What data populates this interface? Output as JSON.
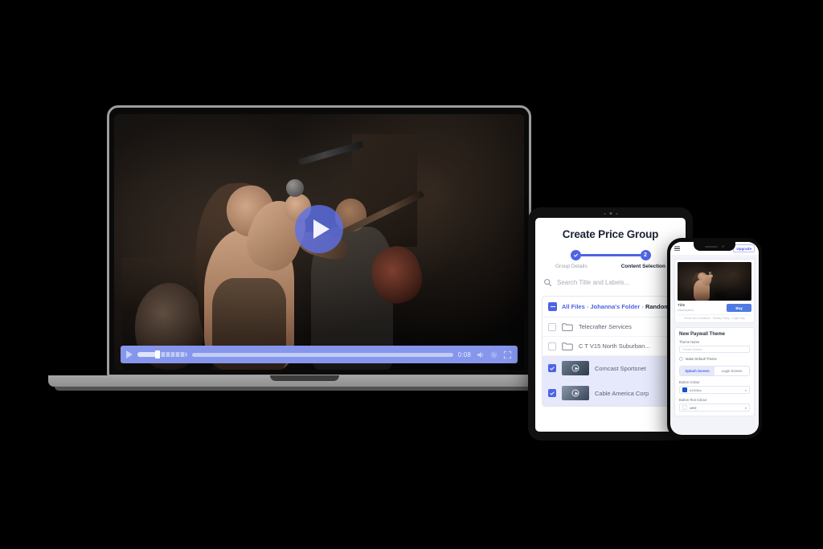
{
  "scene": {
    "background": "#000000",
    "devices": [
      "laptop",
      "tablet",
      "phone"
    ]
  },
  "laptop": {
    "device_name": "laptop",
    "video": {
      "play_overlay": "play-circle-icon",
      "controls": {
        "play_label": "play-icon",
        "volume_icon": "volume-icon",
        "current_time": "0:08",
        "settings_icon": "settings-icon",
        "fullscreen_icon": "fullscreen-icon",
        "volume_level_pct": 38,
        "seek_progress_pct": 1
      },
      "accent_color": "#8596ec"
    }
  },
  "tablet": {
    "device_name": "tablet",
    "title": "Create Price Group",
    "stepper": {
      "steps": [
        {
          "label": "Group Details",
          "state": "done",
          "marker": "check-icon"
        },
        {
          "label": "Content Selection",
          "state": "active",
          "marker": "2"
        }
      ],
      "accent_color": "#4e63e4"
    },
    "search": {
      "icon": "search-icon",
      "placeholder": "Search Title and Labels..."
    },
    "breadcrumb": {
      "toggle_icon": "minus-box-icon",
      "root": "All Files",
      "sep": "›",
      "folder": "Johanna's Folder",
      "current": "Random"
    },
    "file_rows": [
      {
        "type": "folder",
        "name": "Telecrafter Services",
        "checked": false,
        "icon": "folder-icon"
      },
      {
        "type": "folder",
        "name": "C T V15 North Suburban...",
        "checked": false,
        "icon": "folder-icon"
      },
      {
        "type": "video",
        "name": "Comcast Sportsnet",
        "checked": true,
        "icon": "video-thumbnail"
      },
      {
        "type": "video",
        "name": "Cable America Corp",
        "checked": true,
        "icon": "video-thumbnail"
      }
    ]
  },
  "phone": {
    "device_name": "phone",
    "topbar": {
      "menu_icon": "hamburger-menu-icon",
      "upgrade_label": "Upgrade"
    },
    "video_card": {
      "title": "Title",
      "description": "Description",
      "buy_label": "Buy",
      "footer_links": "Terms and Conditions · Privacy Policy · Login Help"
    },
    "theme_form": {
      "heading": "New Paywall Theme",
      "theme_name_label": "Theme Name",
      "theme_name_placeholder": "Theme Name",
      "default_theme_label": "Make Default Theme",
      "tabs": [
        {
          "label": "Splash Screen",
          "active": true
        },
        {
          "label": "Login Screen",
          "active": false
        }
      ],
      "button_colour_label": "Button Colour",
      "button_colour_value": "#1155cc",
      "button_text_colour_label": "Button Text Colour",
      "button_text_colour_value": "#ffffff",
      "caret_icon": "chevron-down-icon"
    }
  }
}
